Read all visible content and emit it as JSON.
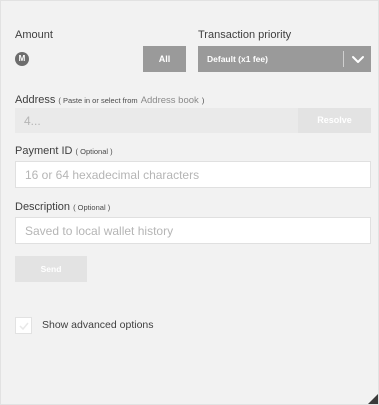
{
  "amount": {
    "label": "Amount",
    "currency_icon": "monero-icon",
    "currency_glyph": "M",
    "value": "",
    "all_label": "All"
  },
  "priority": {
    "label": "Transaction priority",
    "selected": "Default (x1 fee)",
    "chevron_icon": "chevron-down-icon"
  },
  "address": {
    "label": "Address",
    "hint_prefix": "( Paste in or select from",
    "address_book_link": "Address book",
    "hint_suffix": ")",
    "placeholder": "4...",
    "resolve_label": "Resolve"
  },
  "payment_id": {
    "label": "Payment ID",
    "optional": "( Optional )",
    "placeholder": "16 or 64 hexadecimal characters"
  },
  "description": {
    "label": "Description",
    "optional": "( Optional )",
    "placeholder": "Saved to local wallet history"
  },
  "send_label": "Send",
  "advanced": {
    "label": "Show advanced options",
    "checked": false
  },
  "colors": {
    "button_gray": "#9a9a9a",
    "disabled_button": "#e3e3e3",
    "background": "#f2f2f2"
  }
}
